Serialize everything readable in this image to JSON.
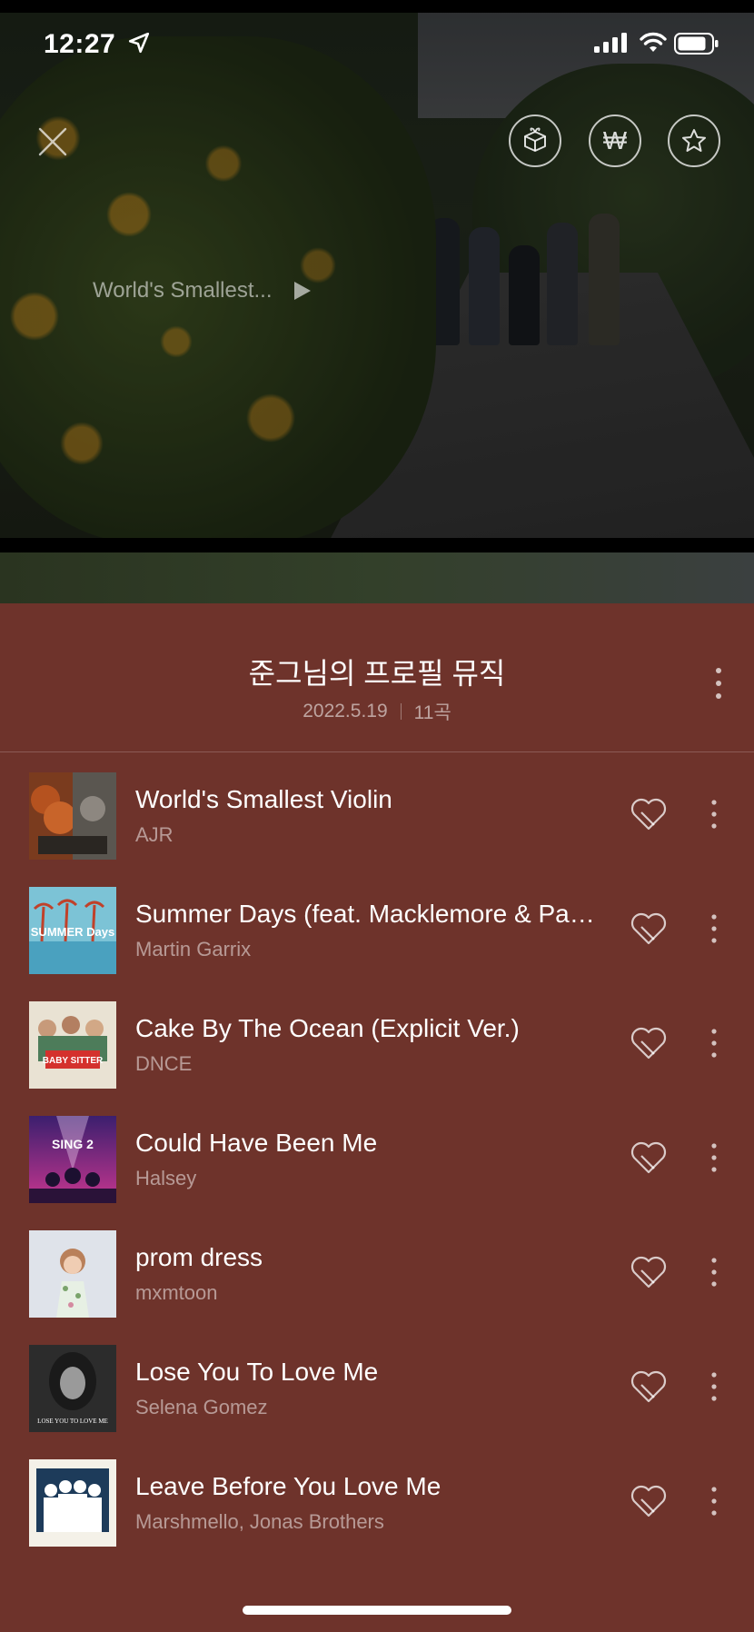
{
  "status_bar": {
    "time": "12:27"
  },
  "header_icons": {
    "close": "close-icon",
    "gift": "gift-icon",
    "won_symbol": "₩",
    "star": "star-icon"
  },
  "now_playing": {
    "title": "World's Smallest...",
    "icon": "play-icon"
  },
  "playlist": {
    "title": "준그님의 프로필 뮤직",
    "date": "2022.5.19",
    "count": "11곡"
  },
  "tracks": [
    {
      "title": "World's Smallest Violin",
      "artist": "AJR"
    },
    {
      "title": "Summer Days (feat. Macklemore & Patrick Stump of Fall Out Boy)",
      "artist": "Martin Garrix"
    },
    {
      "title": "Cake By The Ocean (Explicit Ver.)",
      "artist": "DNCE"
    },
    {
      "title": "Could Have Been Me",
      "artist": "Halsey"
    },
    {
      "title": "prom dress",
      "artist": "mxmtoon"
    },
    {
      "title": "Lose You To Love Me",
      "artist": "Selena Gomez"
    },
    {
      "title": "Leave Before You Love Me",
      "artist": "Marshmello, Jonas Brothers"
    }
  ],
  "album_art_text": {
    "summer_days": "SUMMER Days",
    "babysitter": "BABY SITTER",
    "sing": "SING 2",
    "lose_you": "LOSE YOU TO LOVE ME"
  },
  "colors": {
    "panel_bg": "#6e332b",
    "text_primary": "#ffffff",
    "text_secondary": "rgba(255,255,255,0.5)"
  }
}
